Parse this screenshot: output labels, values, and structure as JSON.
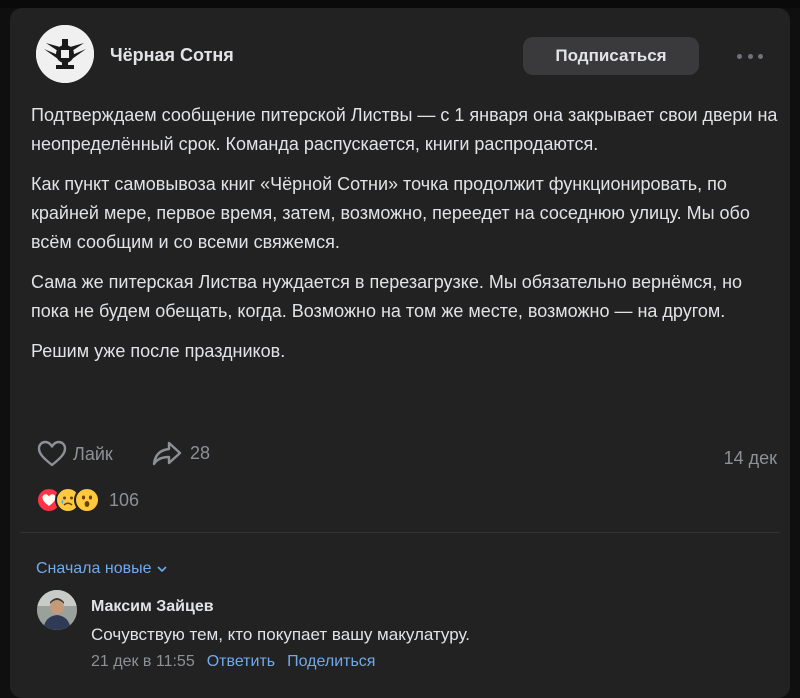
{
  "post": {
    "author": "Чёрная Сотня",
    "subscribe_label": "Подписаться",
    "paragraphs": [
      "Подтверждаем сообщение питерской Листвы — с 1 января она закрывает свои двери на неопределённый срок. Команда распускается, книги распродаются.",
      "Как пункт самовывоза книг «Чёрной Сотни» точка продолжит функционировать, по крайней мере, первое время, затем, возможно, переедет на соседнюю улицу. Мы обо всём сообщим и со всеми свяжемся.",
      "Сама же питерская Листва нуждается в перезагрузке. Мы обязательно вернёмся, но пока не будем обещать, когда. Возможно на том же месте, возможно — на другом.",
      "Решим уже после праздников."
    ],
    "like_label": "Лайк",
    "share_count": "28",
    "date": "14 дек",
    "reactions_count": "106",
    "reaction_icons": [
      "heart-emoji",
      "crying-emoji",
      "surprised-emoji"
    ]
  },
  "comments": {
    "sort_label": "Сначала новые",
    "items": [
      {
        "author": "Максим Зайцев",
        "text": "Сочувствую тем, кто покупает вашу макулатуру.",
        "time": "21 дек в 11:55",
        "reply_label": "Ответить",
        "share_label": "Поделиться"
      }
    ]
  },
  "colors": {
    "background": "#0f0f10",
    "card": "#222222",
    "text": "#e1e3e6",
    "secondary": "#8d9197",
    "link": "#71aaeb"
  }
}
